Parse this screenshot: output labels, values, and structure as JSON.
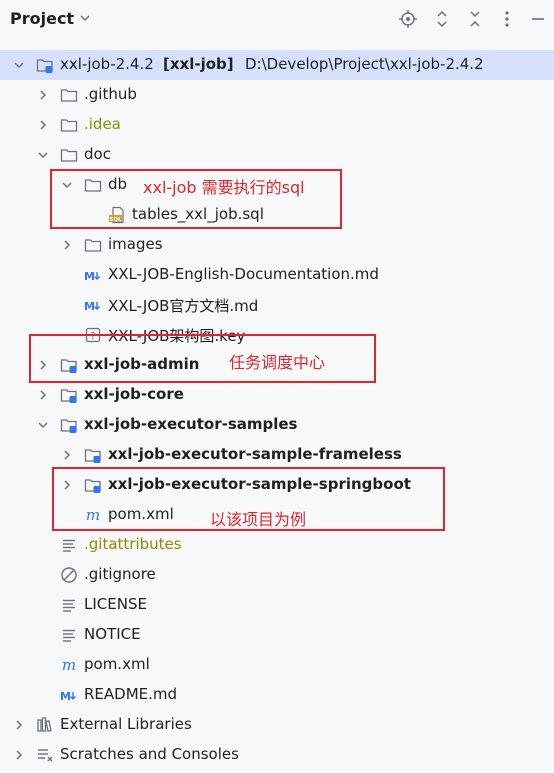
{
  "header": {
    "title": "Project"
  },
  "tree": [
    {
      "label": "xxl-job-2.4.2",
      "extra_bold": "[xxl-job]",
      "extra": "D:\\Develop\\Project\\xxl-job-2.4.2"
    },
    {
      "label": ".github"
    },
    {
      "label": ".idea"
    },
    {
      "label": "doc"
    },
    {
      "label": "db"
    },
    {
      "label": "tables_xxl_job.sql"
    },
    {
      "label": "images"
    },
    {
      "label": "XXL-JOB-English-Documentation.md"
    },
    {
      "label": "XXL-JOB官方文档.md"
    },
    {
      "label": "XXL-JOB架构图.key"
    },
    {
      "label": "xxl-job-admin"
    },
    {
      "label": "xxl-job-core"
    },
    {
      "label": "xxl-job-executor-samples"
    },
    {
      "label": "xxl-job-executor-sample-frameless"
    },
    {
      "label": "xxl-job-executor-sample-springboot"
    },
    {
      "label": "pom.xml"
    },
    {
      "label": ".gitattributes"
    },
    {
      "label": ".gitignore"
    },
    {
      "label": "LICENSE"
    },
    {
      "label": "NOTICE"
    },
    {
      "label": "pom.xml"
    },
    {
      "label": "README.md"
    },
    {
      "label": "External Libraries"
    },
    {
      "label": "Scratches and Consoles"
    }
  ],
  "annotations": {
    "db_note": "xxl-job 需要执行的sql",
    "admin_note": "任务调度中心",
    "springboot_note": "以该项目为例"
  },
  "colors": {
    "selection": "#d5e1ff",
    "annotation": "#e0262b",
    "folder": "#6c707e",
    "module_badge": "#3574f0"
  }
}
